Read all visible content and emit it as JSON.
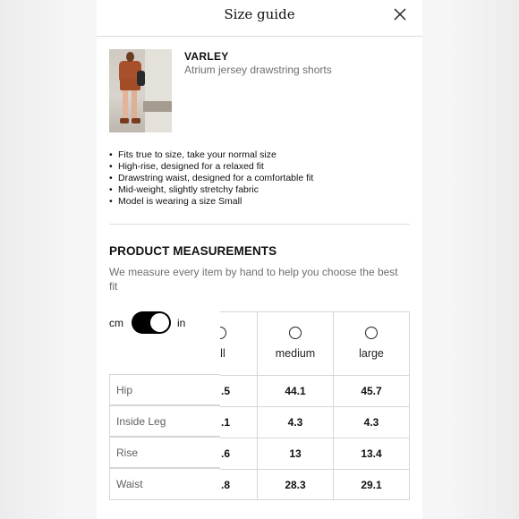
{
  "header": {
    "title": "Size guide"
  },
  "product": {
    "brand": "VARLEY",
    "name": "Atrium jersey drawstring shorts",
    "features": [
      "Fits true to size, take your normal size",
      "High-rise, designed for a relaxed fit",
      "Drawstring waist, designed for a comfortable fit",
      "Mid-weight, slightly stretchy fabric",
      "Model is wearing a size Small"
    ]
  },
  "measurements": {
    "title": "PRODUCT MEASUREMENTS",
    "description": "We measure every item by hand to help you choose the best fit",
    "unit_left": "cm",
    "unit_right": "in",
    "rows": [
      "Hip",
      "Inside Leg",
      "Rise",
      "Waist"
    ],
    "columns": [
      {
        "size": "all",
        "values": [
          ".5",
          ".1",
          ".6",
          ".8"
        ]
      },
      {
        "size": "medium",
        "values": [
          "44.1",
          "4.3",
          "13",
          "28.3"
        ]
      },
      {
        "size": "large",
        "values": [
          "45.7",
          "4.3",
          "13.4",
          "29.1"
        ]
      }
    ]
  },
  "icons": {
    "close": "close-icon",
    "radio": "radio-icon",
    "toggle": "toggle-switch"
  }
}
